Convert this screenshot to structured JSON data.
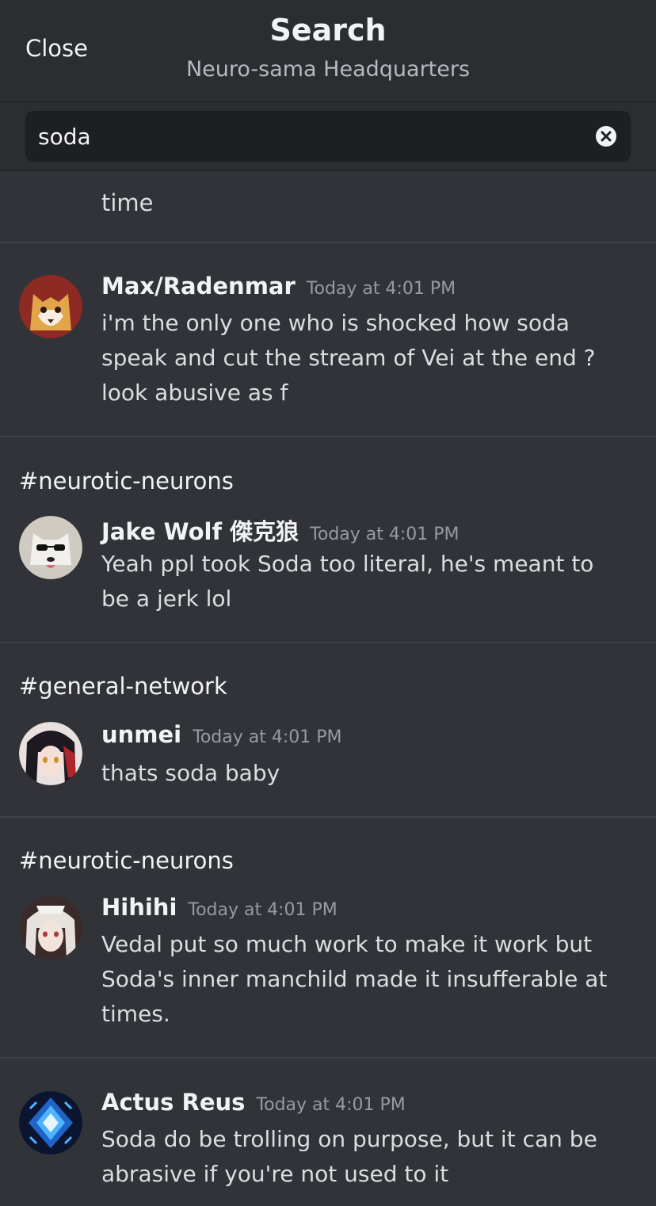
{
  "header": {
    "close_label": "Close",
    "title": "Search",
    "subtitle": "Neuro-sama Headquarters"
  },
  "search": {
    "value": "soda"
  },
  "partial_previous": {
    "text": "time"
  },
  "results": [
    {
      "channel": "",
      "author": "Max/Radenmar",
      "time": "Today at 4:01 PM",
      "text": "i'm the only one who is shocked how soda speak and cut the stream of Vei at the end ? look abusive as f",
      "avatar_icon": "fox-avatar"
    },
    {
      "channel": "#neurotic-neurons",
      "author": "Jake Wolf 傑克狼",
      "time": "Today at 4:01 PM",
      "text": "Yeah ppl took Soda too literal, he's meant to be a jerk lol",
      "avatar_icon": "husky-sunglasses-avatar"
    },
    {
      "channel": "#general-network",
      "author": "unmei",
      "time": "Today at 4:01 PM",
      "text": "thats soda baby",
      "avatar_icon": "anime-girl-avatar"
    },
    {
      "channel": "#neurotic-neurons",
      "author": "Hihihi",
      "time": "Today at 4:01 PM",
      "text": "Vedal put so much work to make it work but Soda's inner manchild made it insufferable at times.",
      "avatar_icon": "white-hair-avatar"
    },
    {
      "channel": "",
      "author": "Actus Reus",
      "time": "Today at 4:01 PM",
      "text": "Soda do be trolling on purpose, but it can be abrasive if you're not used to it",
      "avatar_icon": "blue-crest-avatar"
    }
  ]
}
